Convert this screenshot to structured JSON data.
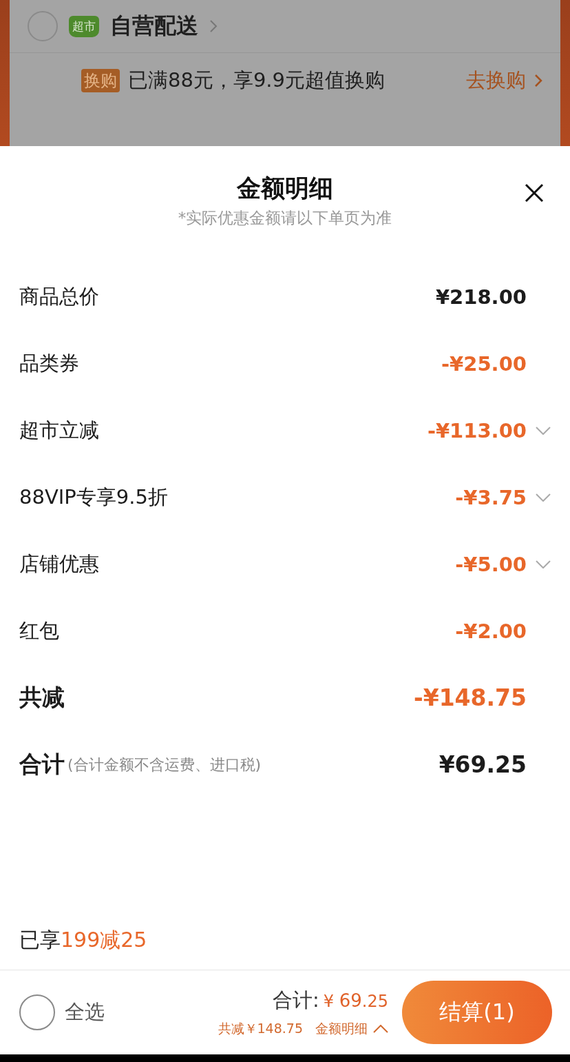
{
  "background_card": {
    "store": {
      "name": "自营配送",
      "badge": "超市",
      "checked": false
    },
    "promo": {
      "tag": "换购",
      "text": "已满88元，享9.9元超值换购",
      "link": "去换购"
    }
  },
  "sheet": {
    "title": "金额明细",
    "subtitle": "*实际优惠金额请以下单页为准",
    "rows": [
      {
        "kind": "price",
        "label": "商品总价",
        "amount": "¥218.00",
        "expandable": false
      },
      {
        "kind": "discount",
        "label": "品类券",
        "amount": "-¥25.00",
        "expandable": false
      },
      {
        "kind": "discount",
        "label": "超市立减",
        "amount": "-¥113.00",
        "expandable": true
      },
      {
        "kind": "discount",
        "label": "88VIP专享9.5折",
        "amount": "-¥3.75",
        "expandable": true
      },
      {
        "kind": "discount",
        "label": "店铺优惠",
        "amount": "-¥5.00",
        "expandable": true
      },
      {
        "kind": "discount",
        "label": "红包",
        "amount": "-¥2.00",
        "expandable": false
      },
      {
        "kind": "saved",
        "label": "共减",
        "amount": "-¥148.75",
        "expandable": false
      },
      {
        "kind": "total",
        "label": "合计",
        "note": "(合计金额不含运费、进口税)",
        "amount": "¥69.25",
        "expandable": false
      }
    ],
    "enjoyed": {
      "prefix": "已享",
      "value": "199减25"
    }
  },
  "footer": {
    "select_all": {
      "label": "全选",
      "checked": false
    },
    "total_label": "合计:",
    "total_currency": "¥",
    "total_int": "69",
    "total_dec": ".25",
    "saved": "共减￥148.75",
    "details_link": "金额明细",
    "checkout": "结算(1)"
  }
}
